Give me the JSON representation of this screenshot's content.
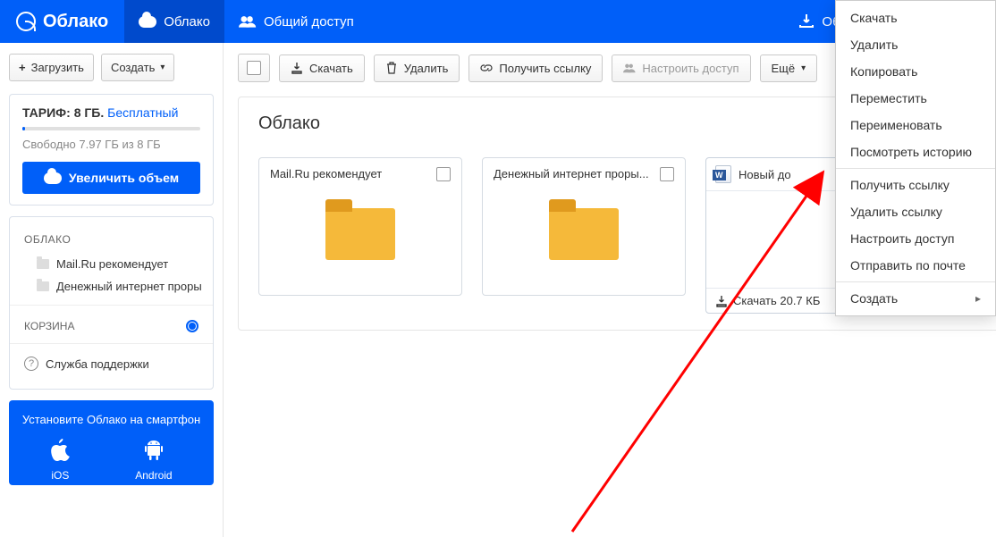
{
  "brand": "Облако",
  "top_tabs": {
    "cloud": "Облако",
    "shared": "Общий доступ"
  },
  "top_right": {
    "download_win": "Облако для Windows"
  },
  "sidebar": {
    "upload": "Загрузить",
    "create": "Создать",
    "tariff_label": "ТАРИФ:",
    "tariff_size": "8 ГБ.",
    "tariff_free": "Бесплатный",
    "freespace": "Свободно 7.97 ГБ из 8 ГБ",
    "increase": "Увеличить объем",
    "section_cloud": "ОБЛАКО",
    "items": [
      {
        "label": "Mail.Ru рекомендует"
      },
      {
        "label": "Денежный интернет прорыв ..."
      }
    ],
    "trash": "КОРЗИНА",
    "support": "Служба поддержки",
    "promo_title": "Установите Облако на смартфон",
    "promo_ios": "iOS",
    "promo_android": "Android"
  },
  "toolbar": {
    "download": "Скачать",
    "delete": "Удалить",
    "get_link": "Получить ссылку",
    "configure": "Настроить доступ",
    "more": "Ещё"
  },
  "breadcrumb": "Облако",
  "tiles": [
    {
      "name": "Mail.Ru рекомендует"
    },
    {
      "name": "Денежный интернет проры..."
    }
  ],
  "docs": [
    {
      "name": "Новый до",
      "download_label": "Скачать 20.7 КБ"
    },
    {
      "name_cut": "Новый"
    }
  ],
  "context_menu": {
    "items1": [
      "Скачать",
      "Удалить",
      "Копировать",
      "Переместить",
      "Переименовать",
      "Посмотреть историю"
    ],
    "items2": [
      "Получить ссылку",
      "Удалить ссылку",
      "Настроить доступ",
      "Отправить по почте"
    ],
    "items3": [
      "Создать"
    ]
  }
}
